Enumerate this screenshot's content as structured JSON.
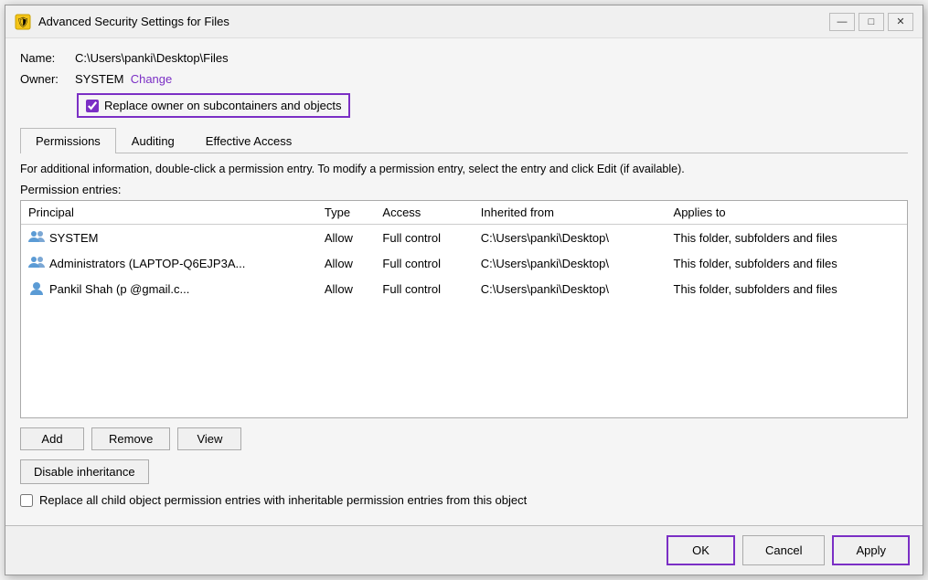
{
  "window": {
    "title": "Advanced Security Settings for Files",
    "icon": "shield-icon"
  },
  "fields": {
    "name_label": "Name:",
    "name_value": "C:\\Users\\panki\\Desktop\\Files",
    "owner_label": "Owner:",
    "owner_value": "SYSTEM",
    "change_link": "Change"
  },
  "checkbox_replace_owner": {
    "label": "Replace owner on subcontainers and objects",
    "checked": true
  },
  "tabs": [
    {
      "id": "permissions",
      "label": "Permissions",
      "active": true
    },
    {
      "id": "auditing",
      "label": "Auditing",
      "active": false
    },
    {
      "id": "effective-access",
      "label": "Effective Access",
      "active": false
    }
  ],
  "info_text": "For additional information, double-click a permission entry. To modify a permission entry, select the entry and click Edit (if available).",
  "perm_entries_label": "Permission entries:",
  "table": {
    "columns": [
      "Principal",
      "Type",
      "Access",
      "Inherited from",
      "Applies to"
    ],
    "rows": [
      {
        "principal": "SYSTEM",
        "type": "Allow",
        "access": "Full control",
        "inherited_from": "C:\\Users\\panki\\Desktop\\",
        "applies_to": "This folder, subfolders and files",
        "icon": "system-icon"
      },
      {
        "principal": "Administrators (LAPTOP-Q6EJP3A...",
        "type": "Allow",
        "access": "Full control",
        "inherited_from": "C:\\Users\\panki\\Desktop\\",
        "applies_to": "This folder, subfolders and files",
        "icon": "admin-icon"
      },
      {
        "principal": "Pankil Shah (p          @gmail.c...",
        "type": "Allow",
        "access": "Full control",
        "inherited_from": "C:\\Users\\panki\\Desktop\\",
        "applies_to": "This folder, subfolders and files",
        "icon": "user-icon"
      }
    ]
  },
  "buttons": {
    "add": "Add",
    "remove": "Remove",
    "view": "View",
    "disable_inheritance": "Disable inheritance"
  },
  "replace_checkbox": {
    "label": "Replace all child object permission entries with inheritable permission entries from this object",
    "checked": false
  },
  "footer": {
    "ok": "OK",
    "cancel": "Cancel",
    "apply": "Apply"
  }
}
